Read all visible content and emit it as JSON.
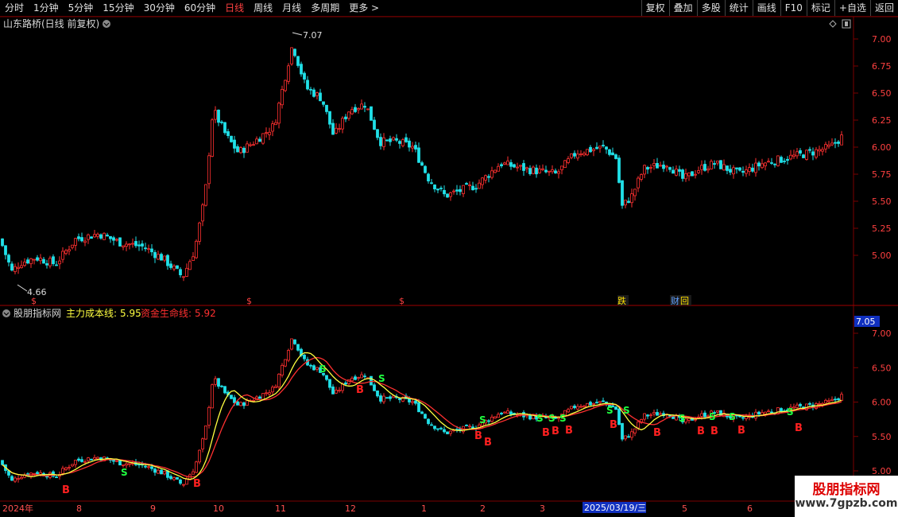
{
  "toolbar": {
    "periods": [
      "分时",
      "1分钟",
      "5分钟",
      "15分钟",
      "30分钟",
      "60分钟",
      "日线",
      "周线",
      "月线",
      "多周期",
      "更多"
    ],
    "active_period": "日线",
    "more_arrow": ">",
    "buttons": [
      "复权",
      "叠加",
      "多股",
      "统计",
      "画线",
      "F10",
      "标记",
      "+自选",
      "返回"
    ]
  },
  "main_panel": {
    "title": "山东路桥(日线 前复权)",
    "high_label": "7.07",
    "low_label": "4.66",
    "y_ticks": [
      "7.00",
      "6.75",
      "6.50",
      "6.25",
      "6.00",
      "5.75",
      "5.50",
      "5.25",
      "5.00"
    ],
    "event_markers": [
      "$",
      "$",
      "$",
      "跌",
      "财",
      "回"
    ]
  },
  "indicator_panel": {
    "name": "股朋指标网",
    "line1_label": "主力成本线:",
    "line1_value": "5.95",
    "line2_label": "资金生命线:",
    "line2_value": "5.92",
    "current_price_tag": "7.05",
    "y_ticks": [
      "7.00",
      "6.50",
      "6.00",
      "5.50",
      "5.00"
    ],
    "signal_b": "B",
    "signal_s": "S"
  },
  "date_axis": {
    "labels": [
      "2024年",
      "8",
      "9",
      "10",
      "11",
      "12",
      "1",
      "2",
      "3",
      "2025/03/19/三",
      "5",
      "6"
    ]
  },
  "watermark": {
    "title": "股朋指标网",
    "url": "www.7gpzb.com"
  },
  "colors": {
    "up": "#ff3030",
    "down": "#20e0e8",
    "cost_line": "#ffff40",
    "life_line": "#ff3030",
    "grid": "#7a0000"
  }
}
